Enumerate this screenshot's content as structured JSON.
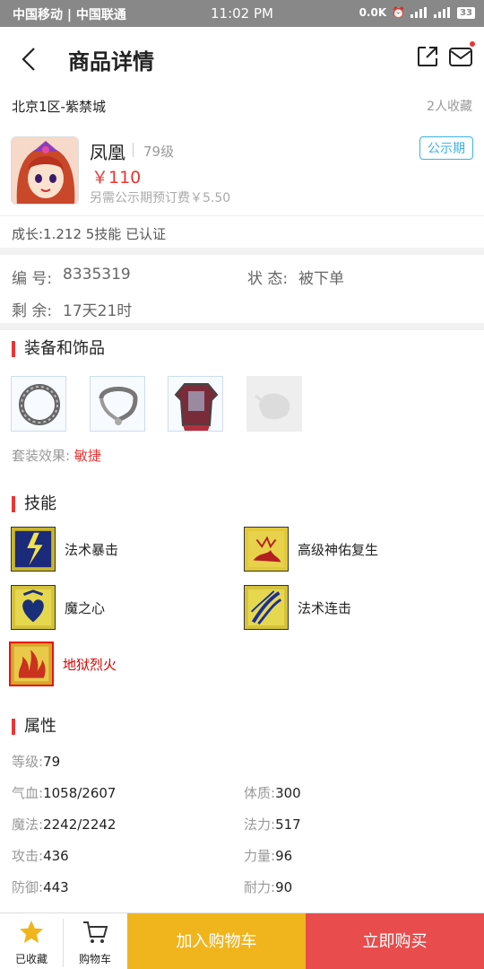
{
  "status_bar": {
    "carrier": "中国移动 | 中国联通",
    "time": "11:02 PM",
    "speed": "0.0K",
    "battery": "33"
  },
  "header": {
    "title": "商品详情"
  },
  "server": {
    "name": "北京1区-紫禁城",
    "favorites": "2人收藏"
  },
  "role": {
    "name": "凤凰",
    "level": "79级",
    "price": "￥110",
    "fee_note": "另需公示期预订费￥5.50",
    "badge": "公示期"
  },
  "growth_line": "成长:1.212 5技能 已认证",
  "info": {
    "id_label": "编  号:",
    "id_value": "8335319",
    "status_label": "状  态:",
    "status_value": "被下单",
    "remaining_label": "剩  余:",
    "remaining_value": "17天21时"
  },
  "equipment": {
    "title": "装备和饰品",
    "suit_label": "套装效果:",
    "suit_value": "敏捷",
    "items": [
      "necklace-ring-icon",
      "bracelet-icon",
      "armor-icon",
      "empty-slot-icon"
    ]
  },
  "skills": {
    "title": "技能",
    "items": [
      {
        "label": "法术暴击"
      },
      {
        "label": "高级神佑复生"
      },
      {
        "label": "魔之心"
      },
      {
        "label": "法术连击"
      },
      {
        "label": "地狱烈火"
      }
    ]
  },
  "attributes": {
    "title": "属性",
    "rows": [
      {
        "k": "等级:",
        "v": "79"
      },
      {
        "k": "气血:",
        "v": "1058/2607"
      },
      {
        "k": "体质:",
        "v": "300"
      },
      {
        "k": "魔法:",
        "v": "2242/2242"
      },
      {
        "k": "法力:",
        "v": "517"
      },
      {
        "k": "攻击:",
        "v": "436"
      },
      {
        "k": "力量:",
        "v": "96"
      },
      {
        "k": "防御:",
        "v": "443"
      },
      {
        "k": "耐力:",
        "v": "90"
      }
    ]
  },
  "bottom": {
    "fav_label": "已收藏",
    "cart_label": "购物车",
    "add_cart": "加入购物车",
    "buy_now": "立即购买"
  },
  "colors": {
    "accent_red": "#e33",
    "badge_blue": "#39b3e6",
    "cart_yellow": "#f0b51d",
    "buy_red": "#e84c4c"
  }
}
